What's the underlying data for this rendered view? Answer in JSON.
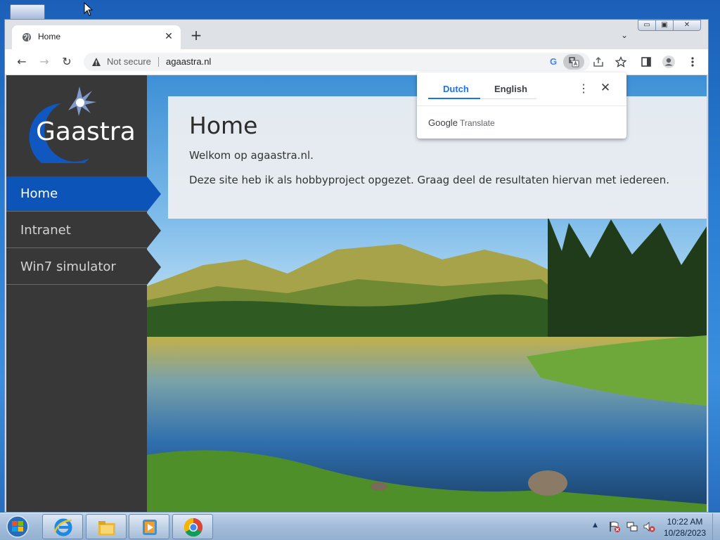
{
  "browser": {
    "tab": {
      "title": "Home",
      "close_glyph": "✕"
    },
    "new_tab_glyph": "+",
    "tab_search_glyph": "⌄",
    "window_controls": {
      "minimize": "▭",
      "maximize": "▣",
      "close": "✕"
    },
    "nav": {
      "back": "←",
      "forward": "→",
      "reload": "↻"
    },
    "omnibox": {
      "security_label": "Not secure",
      "url": "agaastra.nl",
      "google_glyph": "G"
    }
  },
  "site": {
    "logo_text": "Gaastra",
    "nav": [
      {
        "label": "Home",
        "active": true
      },
      {
        "label": "Intranet",
        "active": false
      },
      {
        "label": "Win7 simulator",
        "active": false
      }
    ],
    "content": {
      "title": "Home",
      "intro": "Welkom op agaastra.nl.",
      "body": "Deze site heb ik als hobbyproject opgezet. Graag deel de resultaten hiervan met iedereen."
    }
  },
  "translate_popup": {
    "source_language": "Dutch",
    "target_language": "English",
    "more_glyph": "⋮",
    "close_glyph": "✕",
    "brand_google": "Google",
    "brand_product": "Translate"
  },
  "taskbar": {
    "time": "10:22 AM",
    "date": "10/28/2023",
    "tray_expand_glyph": "▲"
  },
  "colors": {
    "sidebar": "#383838",
    "nav_active": "#0c54b8",
    "translate_accent": "#1a73e8"
  }
}
